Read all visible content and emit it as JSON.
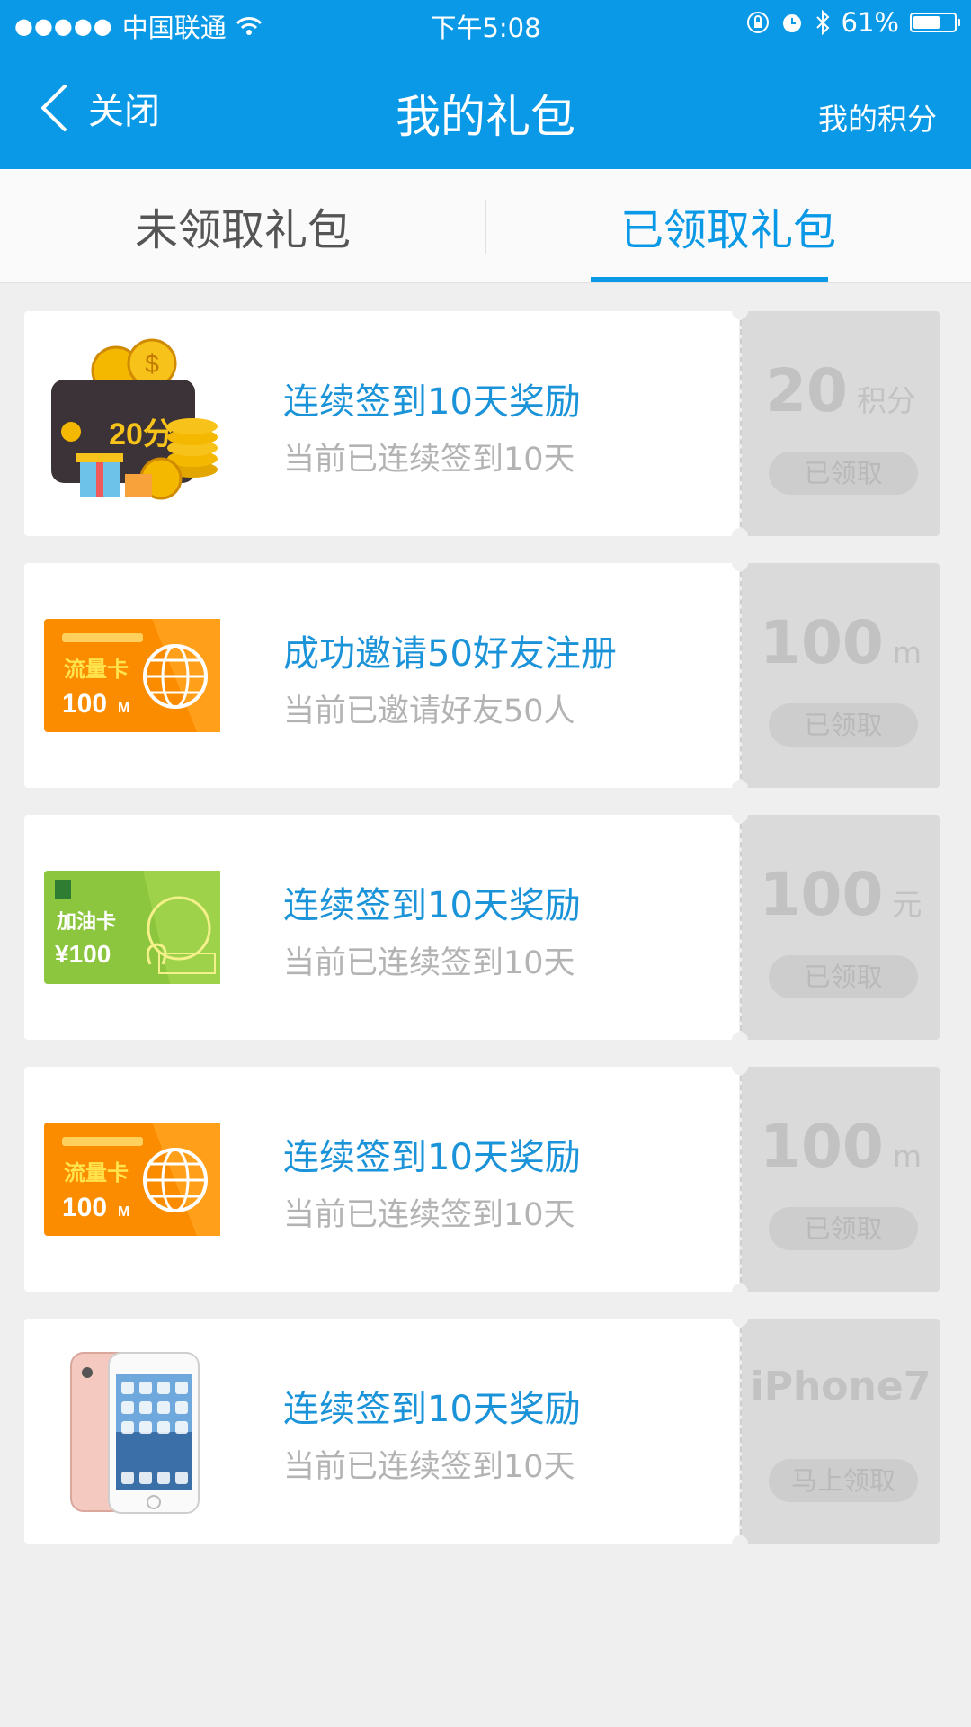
{
  "status_bar": {
    "carrier": "中国联通",
    "time": "下午5:08",
    "battery_text": "61%",
    "battery_level": 0.61
  },
  "nav": {
    "back_label": "关闭",
    "title": "我的礼包",
    "right_label": "我的积分"
  },
  "tabs": [
    {
      "label": "未领取礼包",
      "active": false
    },
    {
      "label": "已领取礼包",
      "active": true
    }
  ],
  "gifts": [
    {
      "title": "连续签到10天奖励",
      "subtitle": "当前已连续签到10天",
      "value": "20",
      "unit": "积分",
      "status": "已领取",
      "image": "coin-wallet-icon",
      "image_text": "20分"
    },
    {
      "title": "成功邀请50好友注册",
      "subtitle": "当前已邀请好友50人",
      "value": "100",
      "unit": "m",
      "status": "已领取",
      "image": "data-card-icon",
      "image_text": "流量卡",
      "image_amount": "100",
      "image_unit": "M"
    },
    {
      "title": "连续签到10天奖励",
      "subtitle": "当前已连续签到10天",
      "value": "100",
      "unit": "元",
      "status": "已领取",
      "image": "fuel-card-icon",
      "image_text": "加油卡",
      "image_amount": "¥100"
    },
    {
      "title": "连续签到10天奖励",
      "subtitle": "当前已连续签到10天",
      "value": "100",
      "unit": "m",
      "status": "已领取",
      "image": "data-card-icon",
      "image_text": "流量卡",
      "image_amount": "100",
      "image_unit": "M"
    },
    {
      "title": "连续签到10天奖励",
      "subtitle": "当前已连续签到10天",
      "value": "iPhone7",
      "unit": "",
      "status": "马上领取",
      "image": "iphone-icon"
    }
  ],
  "colors": {
    "primary": "#0a99e6",
    "title_text": "#1a93d9",
    "muted_text": "#b3b3b3",
    "stub_bg": "#dadada",
    "page_bg": "#efefef"
  }
}
